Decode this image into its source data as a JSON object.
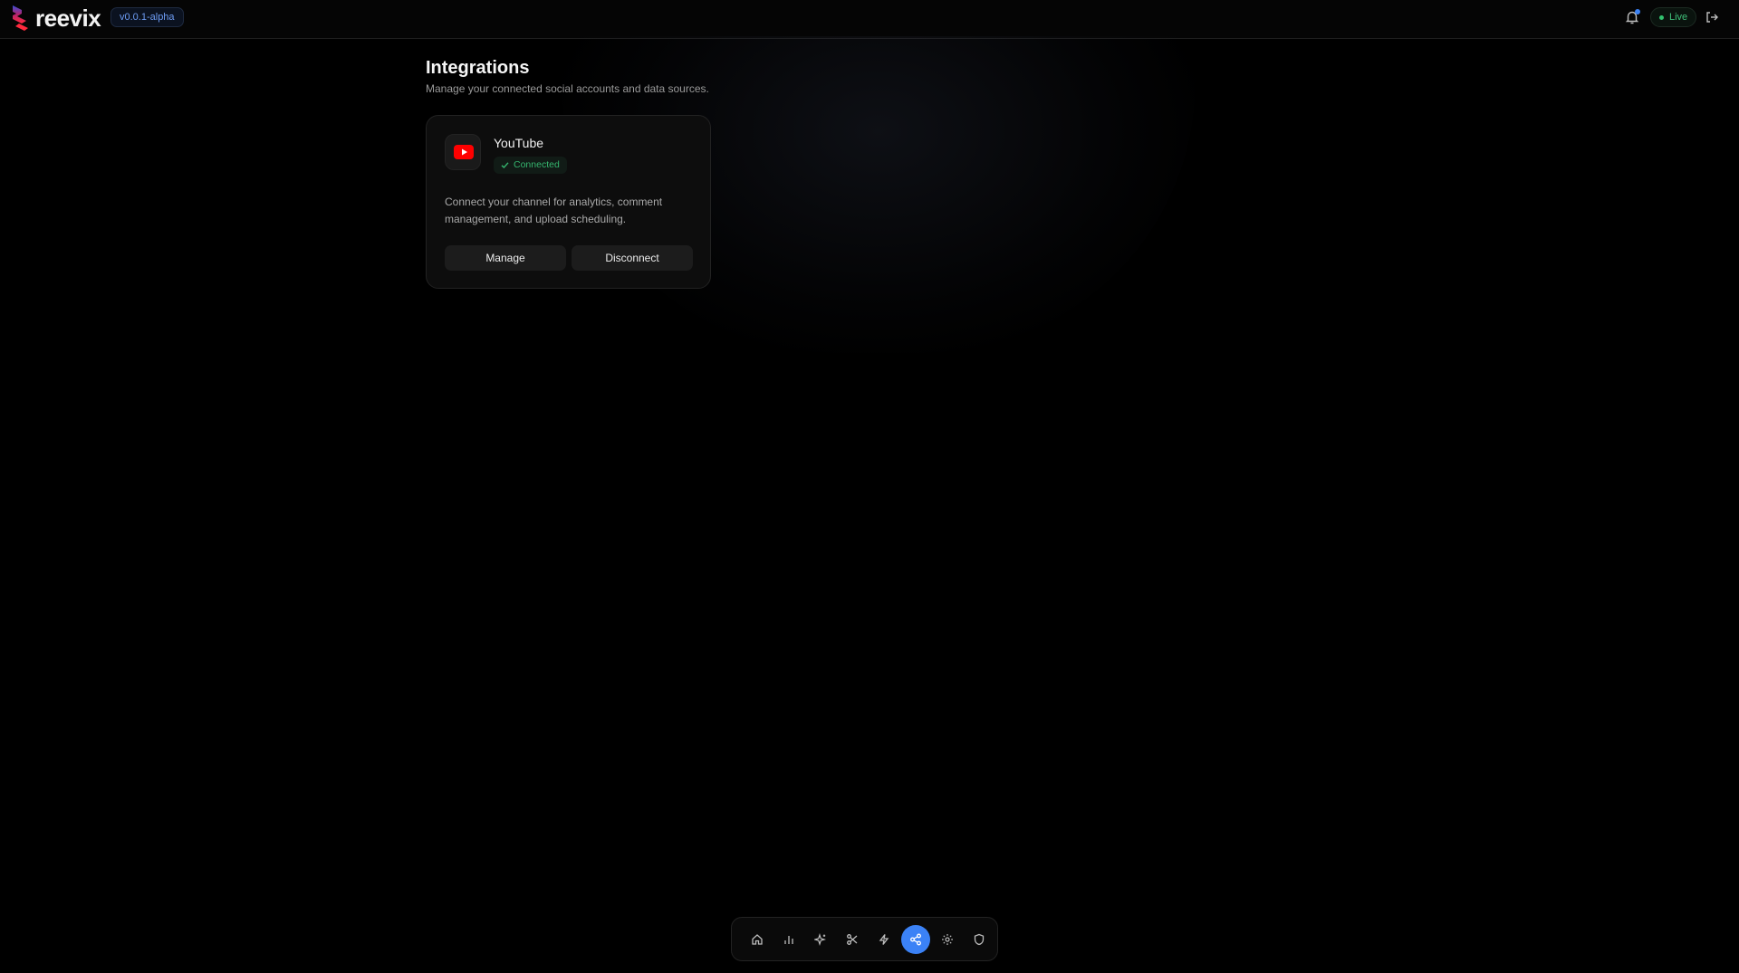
{
  "header": {
    "brand": "reevix",
    "version": "v0.0.1-alpha",
    "live_status": "Live",
    "icons": [
      "brand-logo-icon",
      "bell-icon",
      "logout-icon"
    ]
  },
  "page": {
    "title": "Integrations",
    "subtitle": "Manage your connected social accounts and data sources."
  },
  "integrations": [
    {
      "name": "YouTube",
      "icon": "youtube-icon",
      "status": "Connected",
      "description": "Connect your channel for analytics, comment management, and upload scheduling.",
      "actions": {
        "manage": "Manage",
        "disconnect": "Disconnect"
      }
    }
  ],
  "dock": {
    "items": [
      "home-icon",
      "analytics-icon",
      "sparkles-icon",
      "scissors-icon",
      "lightning-icon",
      "share-icon",
      "settings-icon",
      "shield-icon"
    ],
    "active": "share-icon"
  },
  "colors": {
    "accent": "#3b82f6",
    "success": "#35b56e",
    "youtube_red": "#ff0000"
  }
}
